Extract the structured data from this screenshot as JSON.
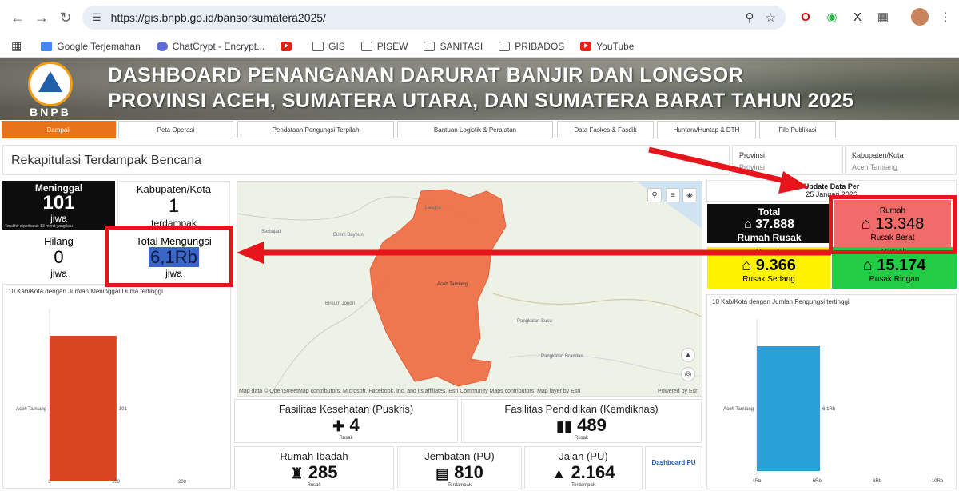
{
  "browser": {
    "url": "https://gis.bnpb.go.id/bansorsumatera2025/",
    "bookmarks": [
      "Google Terjemahan",
      "ChatCrypt - Encrypt...",
      "",
      "GIS",
      "PISEW",
      "SANITASI",
      "PRIBADOS",
      "YouTube"
    ]
  },
  "header": {
    "logo_text": "BNPB",
    "title_line1": "DASHBOARD PENANGANAN DARURAT BANJIR DAN LONGSOR",
    "title_line2": "PROVINSI ACEH, SUMATERA UTARA, DAN SUMATERA BARAT TAHUN 2025"
  },
  "tabs": [
    "Dampak",
    "Peta Operasi",
    "Pendataan Pengungsi Terpilah",
    "Bantuan Logistik & Peralatan",
    "Data Faskes & Fasdik",
    "Huntara/Huntap & DTH",
    "File Publikasi"
  ],
  "rekap_title": "Rekapitulasi Terdampak Bencana",
  "filters": {
    "provinsi_label": "Provinsi",
    "provinsi_value": "Provinsi",
    "kabupaten_label": "Kabupaten/Kota",
    "kabupaten_value": "Aceh Tamiang"
  },
  "stats": {
    "meninggal_label": "Meninggal",
    "meninggal_value": "101",
    "meninggal_unit": "jiwa",
    "meninggal_note": "Terakhir diperbarui: 13 menit yang lalu",
    "kabkota_label": "Kabupaten/Kota",
    "kabkota_value": "1",
    "kabkota_unit": "terdampak",
    "hilang_label": "Hilang",
    "hilang_value": "0",
    "hilang_unit": "jiwa",
    "mengungsi_label": "Total Mengungsi",
    "mengungsi_value": "6,1Rb",
    "mengungsi_unit": "jiwa"
  },
  "update": {
    "label": "Update Data Per",
    "date": "25 Januari 2026"
  },
  "rumah": {
    "total_label": "Total",
    "total_value": "37.888",
    "total_unit": "Rumah Rusak",
    "berat_label": "Rumah",
    "berat_value": "13.348",
    "berat_unit": "Rusak Berat",
    "sedang_label": "Rumah",
    "sedang_value": "9.366",
    "sedang_unit": "Rusak Sedang",
    "ringan_label": "Rumah",
    "ringan_value": "15.174",
    "ringan_unit": "Rusak Ringan"
  },
  "map": {
    "attribution": "Map data © OpenStreetMap contributors, Microsoft, Facebook, Inc. and its affiliates, Esri Community Maps contributors, Map layer by Esri",
    "powered": "Powered by Esri",
    "places": [
      "Serbajadi",
      "Langsa",
      "Birem Bayeun",
      "Bireum Jondri",
      "Aceh Tamiang",
      "Pangkalan Susu",
      "Pangkalan Brandan"
    ]
  },
  "facilities": {
    "kesehatan_label": "Fasilitas Kesehatan (Puskris)",
    "kesehatan_value": "4",
    "kesehatan_unit": "Rusak",
    "pendidikan_label": "Fasilitas Pendidikan (Kemdiknas)",
    "pendidikan_value": "489",
    "pendidikan_unit": "Rusak",
    "ibadah_label": "Rumah Ibadah",
    "ibadah_value": "285",
    "ibadah_unit": "Rusak",
    "jembatan_label": "Jembatan (PU)",
    "jembatan_value": "810",
    "jembatan_unit": "Terdampak",
    "jalan_label": "Jalan (PU)",
    "jalan_value": "2.164",
    "jalan_unit": "Terdampak",
    "pu_link": "Dashboard PU"
  },
  "chart_data": [
    {
      "type": "bar",
      "orientation": "horizontal",
      "title": "10 Kab/Kota dengan Jumlah Meninggal Dunia tertinggi",
      "categories": [
        "Aceh Tamiang"
      ],
      "values": [
        101
      ],
      "value_labels": [
        "101"
      ],
      "xlim": [
        0,
        200
      ],
      "x_ticks": [
        "0",
        "100",
        "200"
      ],
      "color": "#d9451f"
    },
    {
      "type": "bar",
      "orientation": "horizontal",
      "title": "10 Kab/Kota dengan Jumlah Pengungsi tertinggi",
      "categories": [
        "Aceh Tamiang"
      ],
      "values": [
        6100
      ],
      "value_labels": [
        "6,1Rb"
      ],
      "xlim": [
        4000,
        10000
      ],
      "x_ticks": [
        "4Rb",
        "6Rb",
        "8Rb",
        "10Rb"
      ],
      "color": "#2aa0d8"
    }
  ],
  "colors": {
    "accent": "#e8731b",
    "annotation": "#e8141b",
    "berat": "#f26b6b",
    "sedang": "#fff200",
    "ringan": "#22cc44"
  }
}
